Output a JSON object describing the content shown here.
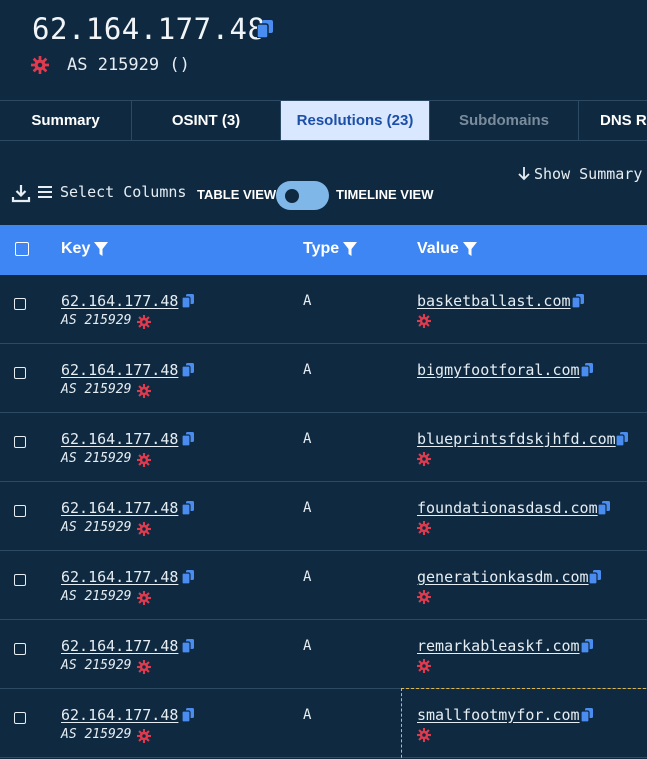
{
  "header": {
    "ip": "62.164.177.48",
    "asn": "AS 215929 ()"
  },
  "tabs": [
    {
      "label": "Summary",
      "state": "normal"
    },
    {
      "label": "OSINT (3)",
      "state": "normal"
    },
    {
      "label": "Resolutions (23)",
      "state": "active"
    },
    {
      "label": "Subdomains",
      "state": "disabled"
    },
    {
      "label": "DNS Re",
      "state": "normal"
    }
  ],
  "toolbar": {
    "select_columns": "Select Columns",
    "table_view": "TABLE VIEW",
    "timeline_view": "TIMELINE VIEW",
    "show_summary": "Show Summary"
  },
  "table": {
    "columns": {
      "key": "Key",
      "type": "Type",
      "value": "Value"
    },
    "rows": [
      {
        "key": "62.164.177.48",
        "asn": "AS 215929",
        "type": "A",
        "value": "basketballast.com",
        "value_flag": true
      },
      {
        "key": "62.164.177.48",
        "asn": "AS 215929",
        "type": "A",
        "value": "bigmyfootforal.com",
        "value_flag": false
      },
      {
        "key": "62.164.177.48",
        "asn": "AS 215929",
        "type": "A",
        "value": "blueprintsfdskjhfd.com",
        "value_flag": true
      },
      {
        "key": "62.164.177.48",
        "asn": "AS 215929",
        "type": "A",
        "value": "foundationasdasd.com",
        "value_flag": true
      },
      {
        "key": "62.164.177.48",
        "asn": "AS 215929",
        "type": "A",
        "value": "generationkasdm.com",
        "value_flag": true
      },
      {
        "key": "62.164.177.48",
        "asn": "AS 215929",
        "type": "A",
        "value": "remarkableaskf.com",
        "value_flag": true
      },
      {
        "key": "62.164.177.48",
        "asn": "AS 215929",
        "type": "A",
        "value": "smallfootmyfor.com",
        "value_flag": true
      }
    ]
  },
  "colors": {
    "background": "#0f2a40",
    "header_bar": "#3f86f5",
    "active_tab": "#d9e8ff",
    "copy_icon": "#4a8cf0",
    "malicious_icon": "#e03a4e",
    "highlight_border": "#e0b84a"
  },
  "icons": [
    "copy-icon",
    "malicious-gear-icon",
    "download-icon",
    "list-icon",
    "arrow-down-icon",
    "filter-icon",
    "checkbox-icon"
  ]
}
